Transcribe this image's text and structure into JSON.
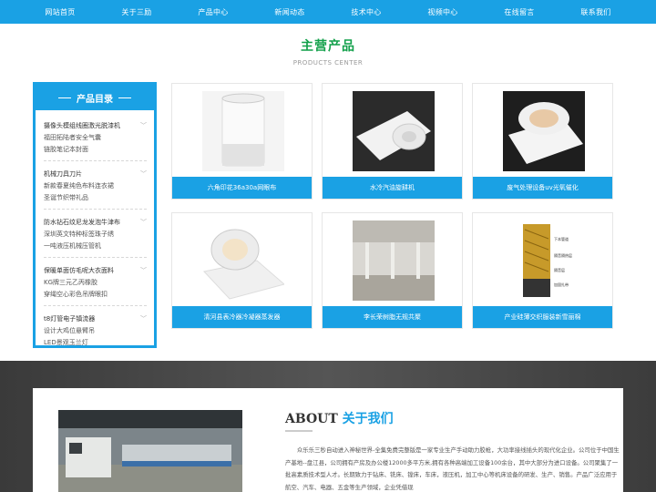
{
  "nav": [
    "网站首页",
    "关于三励",
    "产品中心",
    "新闻动态",
    "技术中心",
    "视频中心",
    "在线留言",
    "联系我们"
  ],
  "section": {
    "title": "主营产品",
    "subtitle": "PRODUCTS CENTER"
  },
  "sidebar": {
    "title": "产品目录",
    "groups": [
      {
        "category": "摄像头模组线圈激光脱漆机",
        "items": [
          "福田拓陆者安全气囊",
          "链胶笔记本封面"
        ]
      },
      {
        "category": "机械刀具刀片",
        "items": [
          "新款春夏纯色布料连衣裙",
          "圣诞节织带礼品"
        ]
      },
      {
        "category": "防水钻石纹尼龙发泡牛津布",
        "items": [
          "深圳英文特种标签珠子绣",
          "一吨液压机械压管机"
        ]
      },
      {
        "category": "保暖单面仿毛呢大衣面料",
        "items": [
          "KG牌三元乙丙橡胶",
          "穿绳空心彩色吊牌眼扣"
        ]
      },
      {
        "category": "t8灯管电子镇流器",
        "items": [
          "设计大鸡位悬臂吊",
          "LED景观玉兰灯"
        ]
      }
    ]
  },
  "products": [
    {
      "caption": "六角印花36a30a网眼布",
      "icon": "fiber-roll-white"
    },
    {
      "caption": "水冷汽油旋耕机",
      "icon": "fiber-roll-folded"
    },
    {
      "caption": "废气处理设备uv光氧催化",
      "icon": "fiber-blanket-dark"
    },
    {
      "caption": "清河县表冷器冷凝器蒸发器",
      "icon": "fiber-blanket-roll"
    },
    {
      "caption": "李长荣树脂无规共聚",
      "icon": "warehouse-photo"
    },
    {
      "caption": "产业硅薄交织服装新雪丽棉",
      "icon": "insulated-pipe-diagram"
    }
  ],
  "product_diagram_labels": [
    "下本管道",
    "隔音隔热层",
    "隔音层",
    "加固扎带"
  ],
  "about": {
    "title_en": "ABOUT",
    "title_zh": "关于我们",
    "text": "众乐乐三秒自动进入神秘世界-全集免费完整版是一家专业生产手动助力胶枪，大功率接线插头的现代化企业。公司位于中国生产基地--盘江县，公司拥有产房及办公楼12000多平方米,拥有各种高端加工设备100余台，其中大部分为进口设备。公司聚集了一批高素质技术型人才。长期致力于钻床、铣床、镗床，车床，液压机，加工中心等机床设备的研发、生产、销售。产品广泛应用于航空、汽车、电器、五金等生产领域，企业凭借现"
  },
  "colors": {
    "brand_blue": "#1aa1e4",
    "title_green": "#12a04a"
  }
}
